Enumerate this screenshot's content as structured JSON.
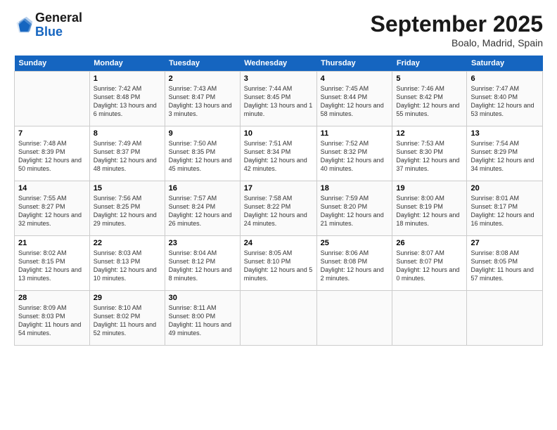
{
  "header": {
    "logo_line1": "General",
    "logo_line2": "Blue",
    "month": "September 2025",
    "location": "Boalo, Madrid, Spain"
  },
  "days_of_week": [
    "Sunday",
    "Monday",
    "Tuesday",
    "Wednesday",
    "Thursday",
    "Friday",
    "Saturday"
  ],
  "weeks": [
    [
      {
        "day": "",
        "sunrise": "",
        "sunset": "",
        "daylight": ""
      },
      {
        "day": "1",
        "sunrise": "Sunrise: 7:42 AM",
        "sunset": "Sunset: 8:48 PM",
        "daylight": "Daylight: 13 hours and 6 minutes."
      },
      {
        "day": "2",
        "sunrise": "Sunrise: 7:43 AM",
        "sunset": "Sunset: 8:47 PM",
        "daylight": "Daylight: 13 hours and 3 minutes."
      },
      {
        "day": "3",
        "sunrise": "Sunrise: 7:44 AM",
        "sunset": "Sunset: 8:45 PM",
        "daylight": "Daylight: 13 hours and 1 minute."
      },
      {
        "day": "4",
        "sunrise": "Sunrise: 7:45 AM",
        "sunset": "Sunset: 8:44 PM",
        "daylight": "Daylight: 12 hours and 58 minutes."
      },
      {
        "day": "5",
        "sunrise": "Sunrise: 7:46 AM",
        "sunset": "Sunset: 8:42 PM",
        "daylight": "Daylight: 12 hours and 55 minutes."
      },
      {
        "day": "6",
        "sunrise": "Sunrise: 7:47 AM",
        "sunset": "Sunset: 8:40 PM",
        "daylight": "Daylight: 12 hours and 53 minutes."
      }
    ],
    [
      {
        "day": "7",
        "sunrise": "Sunrise: 7:48 AM",
        "sunset": "Sunset: 8:39 PM",
        "daylight": "Daylight: 12 hours and 50 minutes."
      },
      {
        "day": "8",
        "sunrise": "Sunrise: 7:49 AM",
        "sunset": "Sunset: 8:37 PM",
        "daylight": "Daylight: 12 hours and 48 minutes."
      },
      {
        "day": "9",
        "sunrise": "Sunrise: 7:50 AM",
        "sunset": "Sunset: 8:35 PM",
        "daylight": "Daylight: 12 hours and 45 minutes."
      },
      {
        "day": "10",
        "sunrise": "Sunrise: 7:51 AM",
        "sunset": "Sunset: 8:34 PM",
        "daylight": "Daylight: 12 hours and 42 minutes."
      },
      {
        "day": "11",
        "sunrise": "Sunrise: 7:52 AM",
        "sunset": "Sunset: 8:32 PM",
        "daylight": "Daylight: 12 hours and 40 minutes."
      },
      {
        "day": "12",
        "sunrise": "Sunrise: 7:53 AM",
        "sunset": "Sunset: 8:30 PM",
        "daylight": "Daylight: 12 hours and 37 minutes."
      },
      {
        "day": "13",
        "sunrise": "Sunrise: 7:54 AM",
        "sunset": "Sunset: 8:29 PM",
        "daylight": "Daylight: 12 hours and 34 minutes."
      }
    ],
    [
      {
        "day": "14",
        "sunrise": "Sunrise: 7:55 AM",
        "sunset": "Sunset: 8:27 PM",
        "daylight": "Daylight: 12 hours and 32 minutes."
      },
      {
        "day": "15",
        "sunrise": "Sunrise: 7:56 AM",
        "sunset": "Sunset: 8:25 PM",
        "daylight": "Daylight: 12 hours and 29 minutes."
      },
      {
        "day": "16",
        "sunrise": "Sunrise: 7:57 AM",
        "sunset": "Sunset: 8:24 PM",
        "daylight": "Daylight: 12 hours and 26 minutes."
      },
      {
        "day": "17",
        "sunrise": "Sunrise: 7:58 AM",
        "sunset": "Sunset: 8:22 PM",
        "daylight": "Daylight: 12 hours and 24 minutes."
      },
      {
        "day": "18",
        "sunrise": "Sunrise: 7:59 AM",
        "sunset": "Sunset: 8:20 PM",
        "daylight": "Daylight: 12 hours and 21 minutes."
      },
      {
        "day": "19",
        "sunrise": "Sunrise: 8:00 AM",
        "sunset": "Sunset: 8:19 PM",
        "daylight": "Daylight: 12 hours and 18 minutes."
      },
      {
        "day": "20",
        "sunrise": "Sunrise: 8:01 AM",
        "sunset": "Sunset: 8:17 PM",
        "daylight": "Daylight: 12 hours and 16 minutes."
      }
    ],
    [
      {
        "day": "21",
        "sunrise": "Sunrise: 8:02 AM",
        "sunset": "Sunset: 8:15 PM",
        "daylight": "Daylight: 12 hours and 13 minutes."
      },
      {
        "day": "22",
        "sunrise": "Sunrise: 8:03 AM",
        "sunset": "Sunset: 8:13 PM",
        "daylight": "Daylight: 12 hours and 10 minutes."
      },
      {
        "day": "23",
        "sunrise": "Sunrise: 8:04 AM",
        "sunset": "Sunset: 8:12 PM",
        "daylight": "Daylight: 12 hours and 8 minutes."
      },
      {
        "day": "24",
        "sunrise": "Sunrise: 8:05 AM",
        "sunset": "Sunset: 8:10 PM",
        "daylight": "Daylight: 12 hours and 5 minutes."
      },
      {
        "day": "25",
        "sunrise": "Sunrise: 8:06 AM",
        "sunset": "Sunset: 8:08 PM",
        "daylight": "Daylight: 12 hours and 2 minutes."
      },
      {
        "day": "26",
        "sunrise": "Sunrise: 8:07 AM",
        "sunset": "Sunset: 8:07 PM",
        "daylight": "Daylight: 12 hours and 0 minutes."
      },
      {
        "day": "27",
        "sunrise": "Sunrise: 8:08 AM",
        "sunset": "Sunset: 8:05 PM",
        "daylight": "Daylight: 11 hours and 57 minutes."
      }
    ],
    [
      {
        "day": "28",
        "sunrise": "Sunrise: 8:09 AM",
        "sunset": "Sunset: 8:03 PM",
        "daylight": "Daylight: 11 hours and 54 minutes."
      },
      {
        "day": "29",
        "sunrise": "Sunrise: 8:10 AM",
        "sunset": "Sunset: 8:02 PM",
        "daylight": "Daylight: 11 hours and 52 minutes."
      },
      {
        "day": "30",
        "sunrise": "Sunrise: 8:11 AM",
        "sunset": "Sunset: 8:00 PM",
        "daylight": "Daylight: 11 hours and 49 minutes."
      },
      {
        "day": "",
        "sunrise": "",
        "sunset": "",
        "daylight": ""
      },
      {
        "day": "",
        "sunrise": "",
        "sunset": "",
        "daylight": ""
      },
      {
        "day": "",
        "sunrise": "",
        "sunset": "",
        "daylight": ""
      },
      {
        "day": "",
        "sunrise": "",
        "sunset": "",
        "daylight": ""
      }
    ]
  ]
}
